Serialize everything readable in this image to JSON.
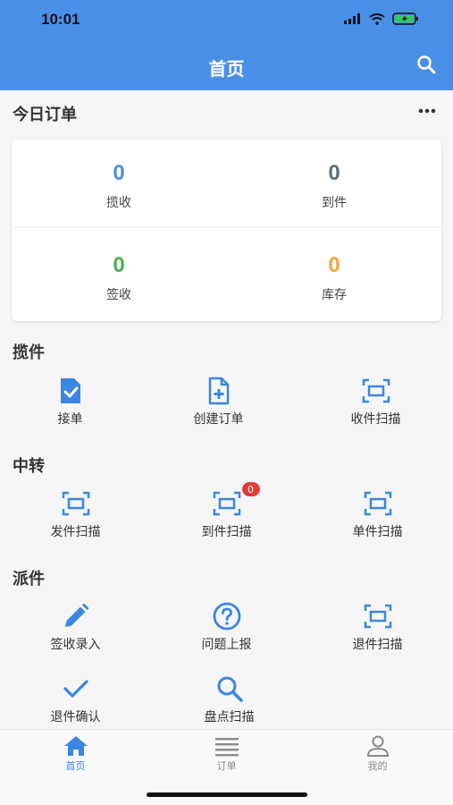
{
  "status_bar": {
    "time": "10:01"
  },
  "nav": {
    "title": "首页"
  },
  "today_orders": {
    "title": "今日订单",
    "stats": [
      {
        "value": "0",
        "label": "揽收",
        "color": "#4a8fe7"
      },
      {
        "value": "0",
        "label": "到件",
        "color": "#5b6e7a"
      },
      {
        "value": "0",
        "label": "签收",
        "color": "#4caf50"
      },
      {
        "value": "0",
        "label": "库存",
        "color": "#f2a33a"
      }
    ]
  },
  "sections": {
    "pickup": {
      "title": "揽件",
      "items": [
        {
          "label": "接单",
          "icon": "task-check-icon"
        },
        {
          "label": "创建订单",
          "icon": "file-add-icon"
        },
        {
          "label": "收件扫描",
          "icon": "scan-icon"
        }
      ]
    },
    "transfer": {
      "title": "中转",
      "items": [
        {
          "label": "发件扫描",
          "icon": "scan-icon"
        },
        {
          "label": "到件扫描",
          "icon": "scan-icon",
          "badge": "0"
        },
        {
          "label": "单件扫描",
          "icon": "scan-icon"
        }
      ]
    },
    "delivery": {
      "title": "派件",
      "items": [
        {
          "label": "签收录入",
          "icon": "pencil-icon"
        },
        {
          "label": "问题上报",
          "icon": "question-icon"
        },
        {
          "label": "退件扫描",
          "icon": "scan-icon"
        },
        {
          "label": "退件确认",
          "icon": "check-icon"
        },
        {
          "label": "盘点扫描",
          "icon": "search-icon"
        }
      ]
    }
  },
  "tabbar": {
    "tabs": [
      {
        "label": "首页",
        "icon": "home-icon",
        "active": true
      },
      {
        "label": "订单",
        "icon": "list-icon",
        "active": false
      },
      {
        "label": "我的",
        "icon": "user-icon",
        "active": false
      }
    ]
  },
  "colors": {
    "primary": "#4a8fe7",
    "icon_blue": "#3a86e0",
    "badge_red": "#e53935",
    "inactive": "#8a8a8a"
  }
}
